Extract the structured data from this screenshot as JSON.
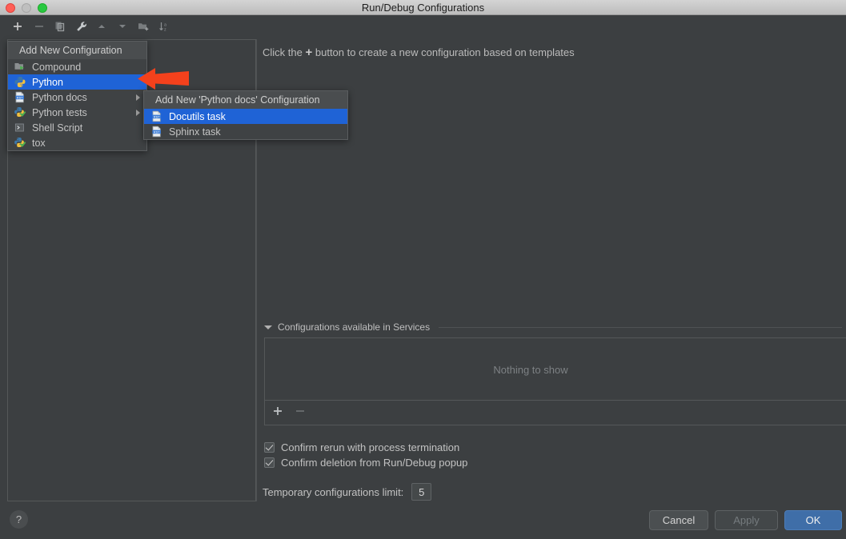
{
  "window": {
    "title": "Run/Debug Configurations",
    "traffic_lights": [
      "close-red",
      "minimize-gray",
      "zoom-green"
    ]
  },
  "toolbar": {
    "buttons": [
      {
        "name": "add",
        "icon": "plus-icon",
        "label": "+"
      },
      {
        "name": "remove",
        "icon": "minus-icon",
        "label": "−"
      },
      {
        "name": "copy",
        "icon": "copy-icon",
        "label": "Copy Configuration"
      },
      {
        "name": "edit-templates",
        "icon": "wrench-icon",
        "label": "Edit Templates"
      },
      {
        "name": "move-up",
        "icon": "arrow-up-icon",
        "label": "Move Up"
      },
      {
        "name": "move-down",
        "icon": "arrow-down-icon",
        "label": "Move Down"
      },
      {
        "name": "new-folder",
        "icon": "folder-add-icon",
        "label": "Create New Folder"
      },
      {
        "name": "sort",
        "icon": "sort-alpha-icon",
        "label": "Sort Configurations"
      }
    ]
  },
  "main": {
    "hint_prefix": "Click the",
    "hint_plus": "+",
    "hint_suffix": "button to create a new configuration based on templates"
  },
  "services_section": {
    "title": "Configurations available in Services",
    "expanded": true,
    "empty_text": "Nothing to show",
    "toolbar": [
      {
        "name": "add",
        "label": "+",
        "enabled": true
      },
      {
        "name": "remove",
        "label": "−",
        "enabled": false
      }
    ]
  },
  "options": {
    "confirm_rerun": {
      "label": "Confirm rerun with process termination",
      "checked": true
    },
    "confirm_deletion": {
      "label": "Confirm deletion from Run/Debug popup",
      "checked": true
    },
    "temp_limit": {
      "label": "Temporary configurations limit:",
      "value": "5"
    }
  },
  "footer": {
    "help_label": "?",
    "cancel_label": "Cancel",
    "apply_label": "Apply",
    "apply_enabled": false,
    "ok_label": "OK"
  },
  "menu": {
    "header": "Add New Configuration",
    "items": [
      {
        "label": "Compound",
        "icon": "compound-icon",
        "selected": false,
        "submenu": false
      },
      {
        "label": "Python",
        "icon": "python-icon",
        "selected": true,
        "submenu": false
      },
      {
        "label": "Python docs",
        "icon": "rst-doc-icon",
        "selected": false,
        "submenu": true
      },
      {
        "label": "Python tests",
        "icon": "python-test-icon",
        "selected": false,
        "submenu": true
      },
      {
        "label": "Shell Script",
        "icon": "terminal-icon",
        "selected": false,
        "submenu": false
      },
      {
        "label": "tox",
        "icon": "tox-icon",
        "selected": false,
        "submenu": false
      }
    ]
  },
  "submenu": {
    "header": "Add New 'Python docs' Configuration",
    "items": [
      {
        "label": "Docutils task",
        "icon": "rst-doc-icon",
        "selected": true
      },
      {
        "label": "Sphinx task",
        "icon": "rst-doc-icon",
        "selected": false
      }
    ]
  },
  "annotation": {
    "arrow": {
      "name": "red-arrow-annotation",
      "direction": "left",
      "color": "#f4411c"
    }
  },
  "colors": {
    "window_bg": "#3c3f41",
    "selection_blue": "#1f63d6",
    "ok_button_blue": "#3f6ea8",
    "annotation_red": "#f4411c",
    "titlebar": "#c9c9c9"
  }
}
